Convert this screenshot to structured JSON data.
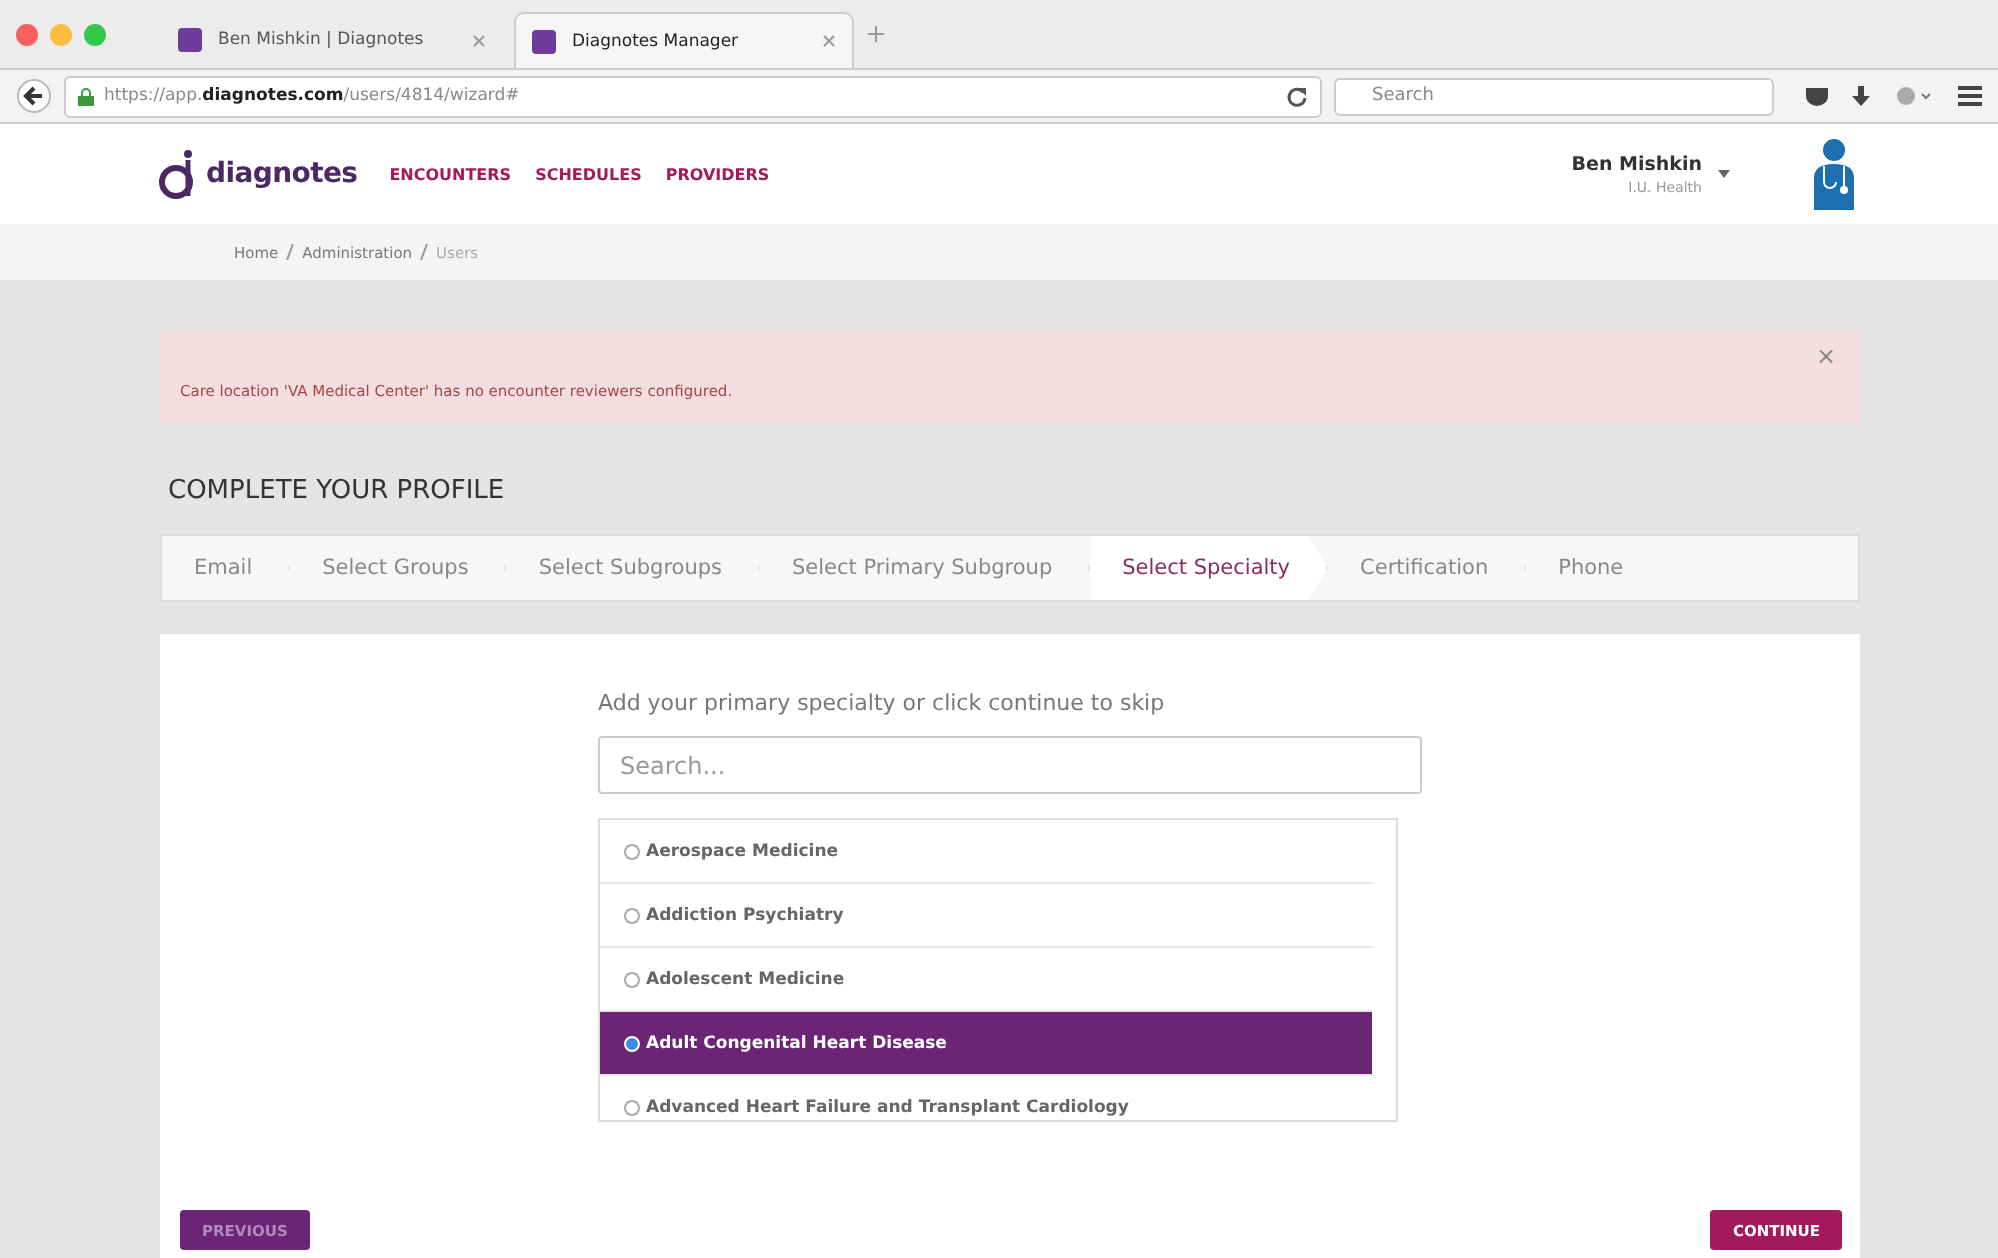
{
  "browser": {
    "tabs": [
      {
        "title": "Ben Mishkin | Diagnotes",
        "selected": false
      },
      {
        "title": "Diagnotes Manager",
        "selected": true
      }
    ],
    "url_prefix": "https://app.",
    "url_domain": "diagnotes.com",
    "url_path": "/users/4814/wizard#",
    "search": {
      "placeholder": "Search"
    }
  },
  "header": {
    "logo": "diagnotes",
    "nav": [
      "ENCOUNTERS",
      "SCHEDULES",
      "PROVIDERS"
    ],
    "user_name": "Ben Mishkin",
    "user_org": "I.U. Health"
  },
  "breadcrumbs": [
    "Home",
    "Administration",
    "Users"
  ],
  "alert": {
    "message": "Care location 'VA Medical Center' has no encounter reviewers configured.",
    "close": "×"
  },
  "heading": "COMPLETE YOUR PROFILE",
  "steps": [
    {
      "label": "Email",
      "selected": false
    },
    {
      "label": "Select Groups",
      "selected": false
    },
    {
      "label": "Select Subgroups",
      "selected": false
    },
    {
      "label": "Select Primary Subgroup",
      "selected": false
    },
    {
      "label": "Select Specialty",
      "selected": true
    },
    {
      "label": "Certification",
      "selected": false
    },
    {
      "label": "Phone",
      "selected": false
    }
  ],
  "prompt": "Add your primary specialty or click continue to skip",
  "search": {
    "placeholder": "Search..."
  },
  "specialties": [
    {
      "name": "Aerospace Medicine",
      "selected": false
    },
    {
      "name": "Addiction Psychiatry",
      "selected": false
    },
    {
      "name": "Adolescent Medicine",
      "selected": false
    },
    {
      "name": "Adult Congenital Heart Disease",
      "selected": true
    },
    {
      "name": "Advanced Heart Failure and Transplant Cardiology",
      "selected": false
    }
  ],
  "buttons": {
    "previous": {
      "label": "PREVIOUS",
      "disabled": true
    },
    "continue": {
      "label": "CONTINUE",
      "disabled": false
    }
  }
}
